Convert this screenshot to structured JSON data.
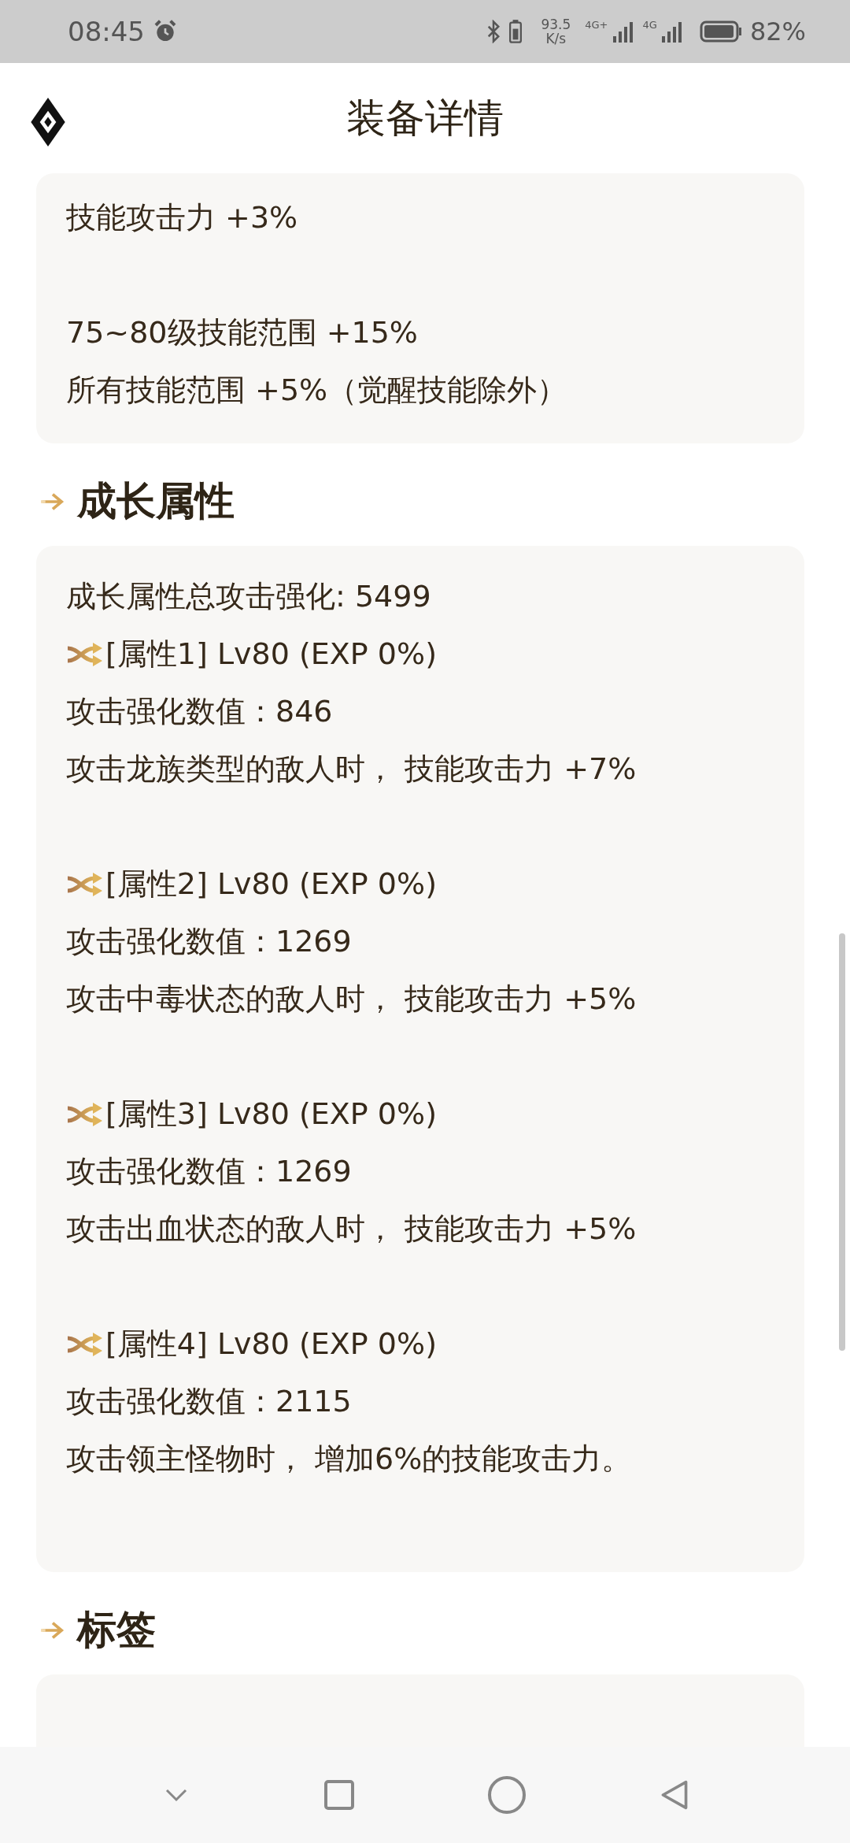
{
  "status_bar": {
    "time": "08:45",
    "speed_value": "93.5",
    "speed_unit": "K/s",
    "network_1": "4G+",
    "network_2": "4G",
    "battery": "82%"
  },
  "header": {
    "title": "装备详情"
  },
  "effects_card": {
    "groups": [
      [
        "技能攻击力 +3%"
      ],
      [
        "75~80级技能范围 +15%",
        "所有技能范围 +5%（觉醒技能除外）"
      ]
    ]
  },
  "growth": {
    "title": "成长属性",
    "total": "成长属性总攻击强化: 5499",
    "attributes": [
      {
        "title": "[属性1] Lv80 (EXP 0%)",
        "value": "攻击强化数值：846",
        "effect": "攻击龙族类型的敌人时， 技能攻击力 +7%"
      },
      {
        "title": "[属性2] Lv80 (EXP 0%)",
        "value": "攻击强化数值：1269",
        "effect": "攻击中毒状态的敌人时， 技能攻击力 +5%"
      },
      {
        "title": "[属性3] Lv80 (EXP 0%)",
        "value": "攻击强化数值：1269",
        "effect": "攻击出血状态的敌人时， 技能攻击力 +5%"
      },
      {
        "title": "[属性4] Lv80 (EXP 0%)",
        "value": "攻击强化数值：2115",
        "effect": "攻击领主怪物时， 增加6%的技能攻击力。"
      }
    ]
  },
  "tags": {
    "title": "标签"
  }
}
